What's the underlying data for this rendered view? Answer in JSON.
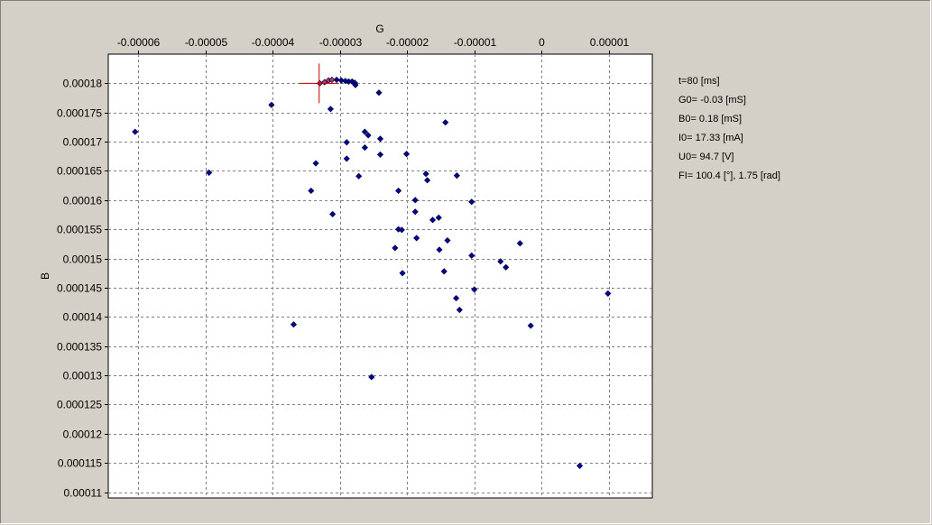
{
  "chart_data": {
    "type": "scatter",
    "xlabel": "G",
    "ylabel": "B",
    "xlim": [
      -6.45e-05,
      1.65e-05
    ],
    "ylim": [
      0.000109,
      0.000185
    ],
    "x_ticks": [
      -6e-05,
      -5e-05,
      -4e-05,
      -3e-05,
      -2e-05,
      -1e-05,
      0,
      1e-05
    ],
    "x_tick_labels": [
      "-0.00006",
      "-0.00005",
      "-0.00004",
      "-0.00003",
      "-0.00002",
      "-0.00001",
      "0",
      "0.00001"
    ],
    "y_ticks": [
      0.00011,
      0.000115,
      0.00012,
      0.000125,
      0.00013,
      0.000135,
      0.00014,
      0.000145,
      0.00015,
      0.000155,
      0.00016,
      0.000165,
      0.00017,
      0.000175,
      0.00018
    ],
    "y_tick_labels": [
      "0.00011",
      "0.000115",
      "0.00012",
      "0.000125",
      "0.00013",
      "0.000135",
      "0.00014",
      "0.000145",
      "0.00015",
      "0.000155",
      "0.00016",
      "0.000165",
      "0.00017",
      "0.000175",
      "0.00018"
    ],
    "grid": true,
    "marker_color": "#0000a0",
    "highlight_color": "#c04060",
    "cursor": {
      "x": -3.31e-05,
      "y": 0.00018,
      "color": "#c00000"
    },
    "points": [
      [
        -6.05e-05,
        0.0001717
      ],
      [
        -4.95e-05,
        0.0001647
      ],
      [
        -4.02e-05,
        0.0001763
      ],
      [
        -3.69e-05,
        0.0001387
      ],
      [
        -3.43e-05,
        0.0001616
      ],
      [
        -3.36e-05,
        0.0001663
      ],
      [
        -3.14e-05,
        0.0001756
      ],
      [
        -3.11e-05,
        0.0001576
      ],
      [
        -2.9e-05,
        0.0001699
      ],
      [
        -2.9e-05,
        0.0001671
      ],
      [
        -2.72e-05,
        0.0001641
      ],
      [
        -2.63e-05,
        0.0001717
      ],
      [
        -2.63e-05,
        0.000169
      ],
      [
        -2.58e-05,
        0.0001711
      ],
      [
        -2.53e-05,
        0.0001297
      ],
      [
        -2.42e-05,
        0.0001784
      ],
      [
        -2.4e-05,
        0.0001705
      ],
      [
        -2.4e-05,
        0.0001678
      ],
      [
        -2.18e-05,
        0.0001518
      ],
      [
        -2.13e-05,
        0.0001616
      ],
      [
        -2.13e-05,
        0.000155
      ],
      [
        -2.08e-05,
        0.0001549
      ],
      [
        -2.07e-05,
        0.0001475
      ],
      [
        -2.01e-05,
        0.0001679
      ],
      [
        -1.88e-05,
        0.00016
      ],
      [
        -1.88e-05,
        0.000158
      ],
      [
        -1.86e-05,
        0.0001535
      ],
      [
        -1.72e-05,
        0.0001645
      ],
      [
        -1.7e-05,
        0.0001634
      ],
      [
        -1.62e-05,
        0.0001566
      ],
      [
        -1.53e-05,
        0.000157
      ],
      [
        -1.52e-05,
        0.0001515
      ],
      [
        -1.45e-05,
        0.0001478
      ],
      [
        -1.43e-05,
        0.0001733
      ],
      [
        -1.4e-05,
        0.0001531
      ],
      [
        -1.27e-05,
        0.0001432
      ],
      [
        -1.26e-05,
        0.0001642
      ],
      [
        -1.22e-05,
        0.0001412
      ],
      [
        -1.04e-05,
        0.0001597
      ],
      [
        -1.04e-05,
        0.0001505
      ],
      [
        -1e-05,
        0.0001447
      ],
      [
        -6.1e-06,
        0.0001495
      ],
      [
        -5.3e-06,
        0.0001485
      ],
      [
        -3.2e-06,
        0.0001526
      ],
      [
        -1.6e-06,
        0.0001385
      ],
      [
        5.7e-06,
        0.0001145
      ],
      [
        9.9e-06,
        0.000144
      ]
    ],
    "highlight_points": [
      [
        -3.3e-05,
        0.00018
      ],
      [
        -3.23e-05,
        0.0001802
      ],
      [
        -3.17e-05,
        0.0001805
      ],
      [
        -3.12e-05,
        0.0001806
      ],
      [
        -3.05e-05,
        0.0001806
      ],
      [
        -2.98e-05,
        0.0001805
      ],
      [
        -2.92e-05,
        0.0001804
      ],
      [
        -2.87e-05,
        0.0001803
      ],
      [
        -2.82e-05,
        0.0001803
      ],
      [
        -2.78e-05,
        0.0001801
      ],
      [
        -2.77e-05,
        0.0001797
      ]
    ]
  },
  "info": {
    "t": "t=80 [ms]",
    "g0": "G0= -0.03 [mS]",
    "b0": "B0= 0.18 [mS]",
    "i0": "I0= 17.33 [mA]",
    "u0": "U0= 94.7 [V]",
    "fi": "FI= 100.4 [°], 1.75 [rad]"
  }
}
